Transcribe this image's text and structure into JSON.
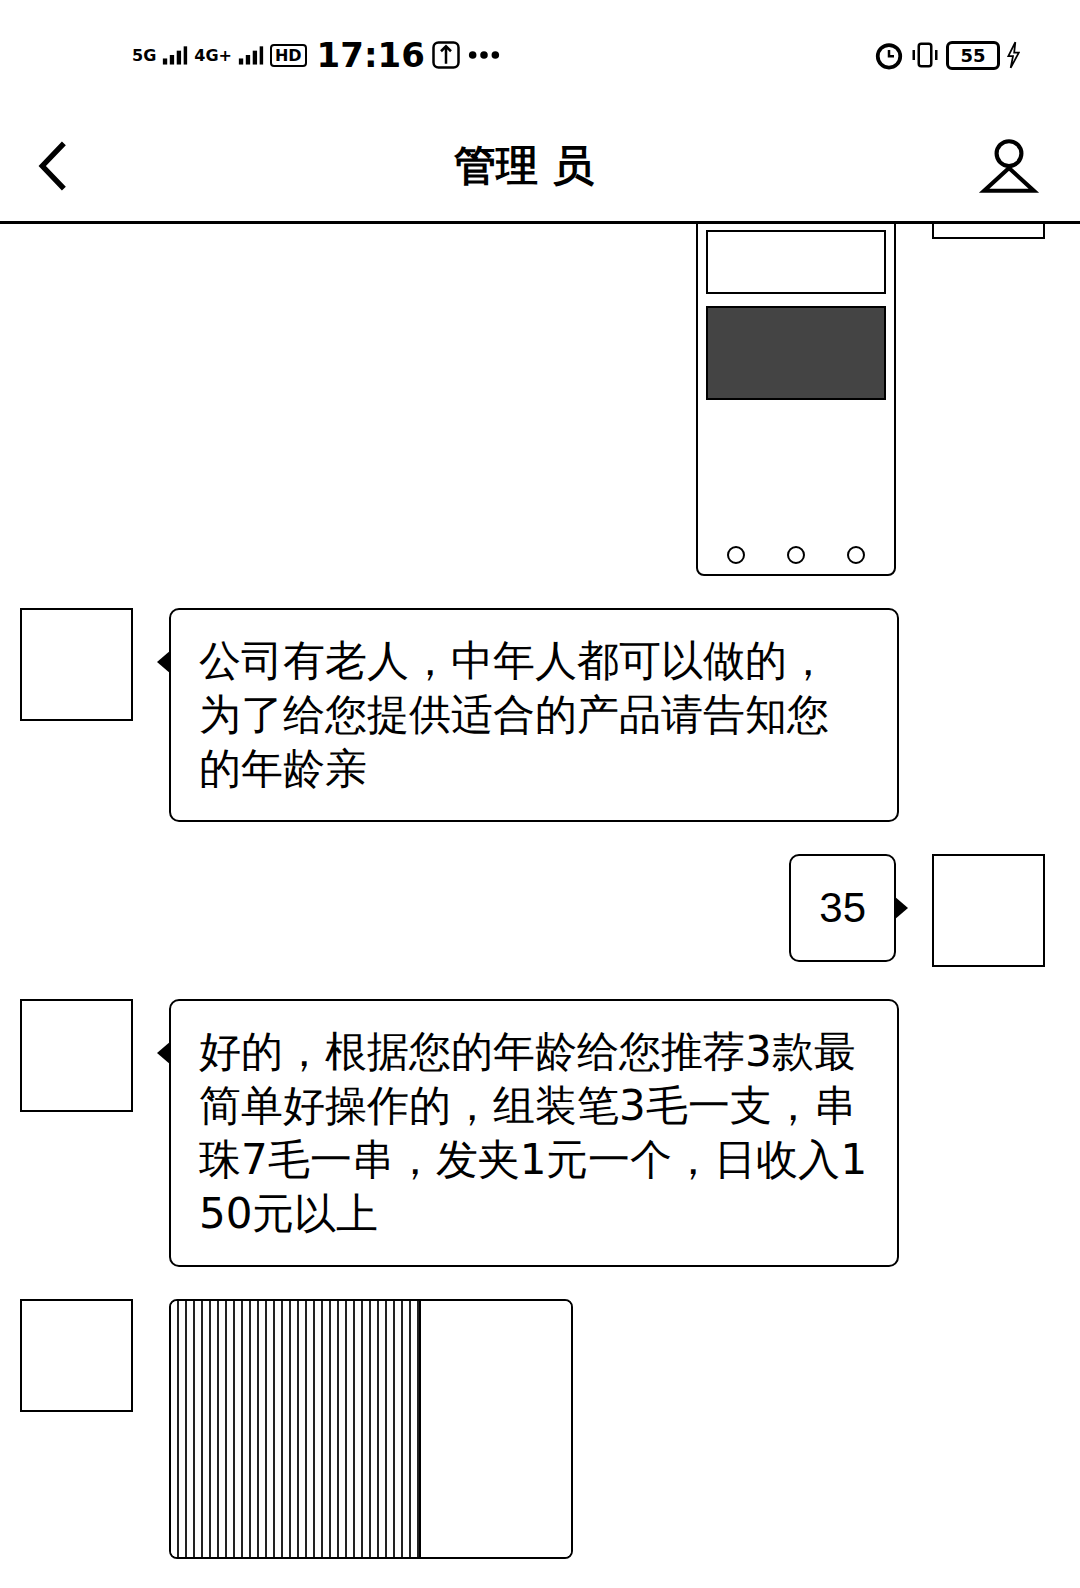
{
  "status_bar": {
    "network_1": "5G",
    "network_2": "4G+",
    "hd": "HD",
    "time": "17:16",
    "battery": "55"
  },
  "header": {
    "title": "管理 员"
  },
  "messages": [
    {
      "kind": "image",
      "side": "right",
      "text": ""
    },
    {
      "kind": "text",
      "side": "left",
      "text": "公司有老人，中年人都可以做的，为了给您提供适合的产品请告知您的年龄亲"
    },
    {
      "kind": "text",
      "side": "right",
      "text": "35"
    },
    {
      "kind": "text",
      "side": "left",
      "text": "好的，根据您的年龄给您推荐3款最简单好操作的，组装笔3毛一支，串珠7毛一串，发夹1元一个，日收入150元以上"
    },
    {
      "kind": "photo",
      "side": "left",
      "text": ""
    }
  ]
}
